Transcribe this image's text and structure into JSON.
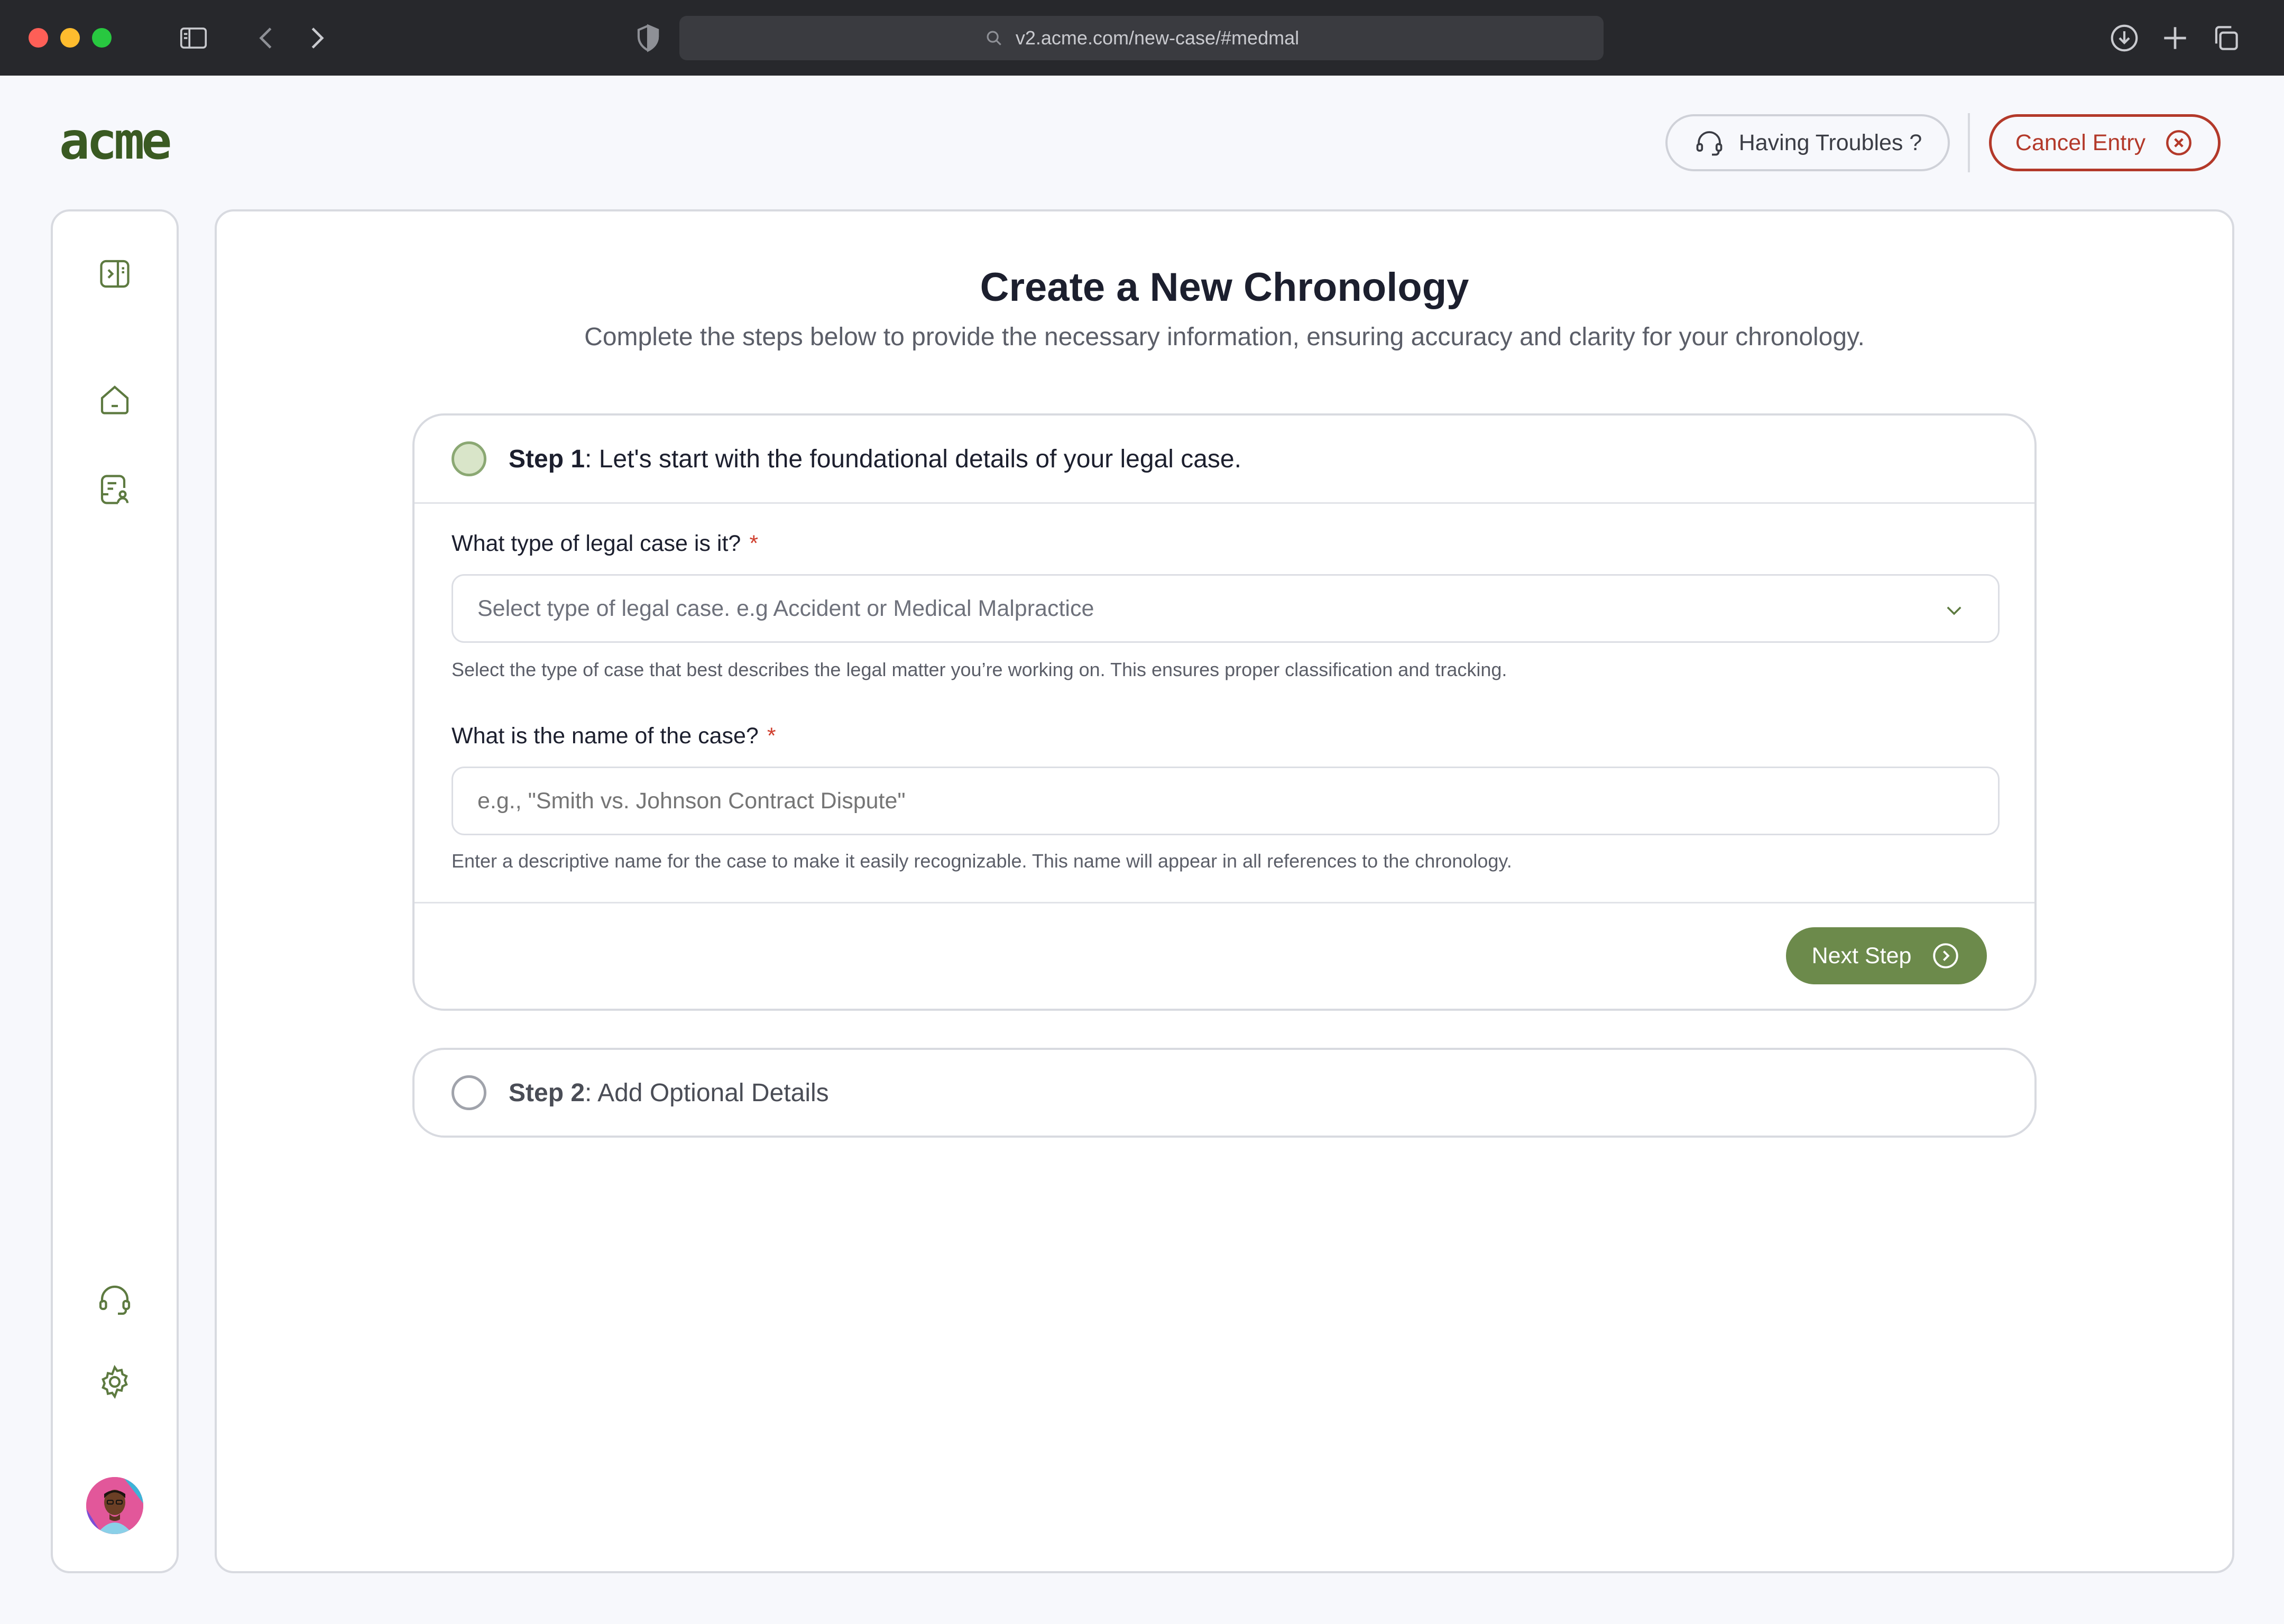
{
  "browser": {
    "url": "v2.acme.com/new-case/#medmal"
  },
  "header": {
    "logo_text": "acme",
    "troubles_label": "Having Troubles ?",
    "cancel_label": "Cancel Entry"
  },
  "sidebar": {
    "icons": [
      "sidebar-toggle-icon",
      "home-icon",
      "document-user-icon",
      "headset-icon",
      "settings-icon"
    ]
  },
  "page": {
    "title": "Create a New Chronology",
    "subtitle": "Complete the steps below to provide the necessary information, ensuring accuracy and clarity for your chronology."
  },
  "step1": {
    "label": "Step 1",
    "heading": ": Let's start with the foundational details of your legal case.",
    "case_type": {
      "label": "What type of legal case is it?",
      "required_mark": "*",
      "placeholder": "Select type of legal case. e.g Accident or Medical Malpractice",
      "help": "Select the type of case that best describes the legal matter you’re working on. This ensures proper classification and tracking."
    },
    "case_name": {
      "label": "What is the name of the case?",
      "required_mark": "*",
      "placeholder": "e.g., \"Smith vs. Johnson Contract Dispute\"",
      "help": "Enter a descriptive name for the case to make it easily recognizable. This name will appear in all references to the chronology."
    },
    "next_label": "Next Step"
  },
  "step2": {
    "label": "Step 2",
    "heading": ": Add Optional Details"
  },
  "colors": {
    "brand_green": "#6c8a4b",
    "logo_green": "#3a5a22",
    "cancel_red": "#b3392a",
    "chrome_bg": "#27282c"
  }
}
